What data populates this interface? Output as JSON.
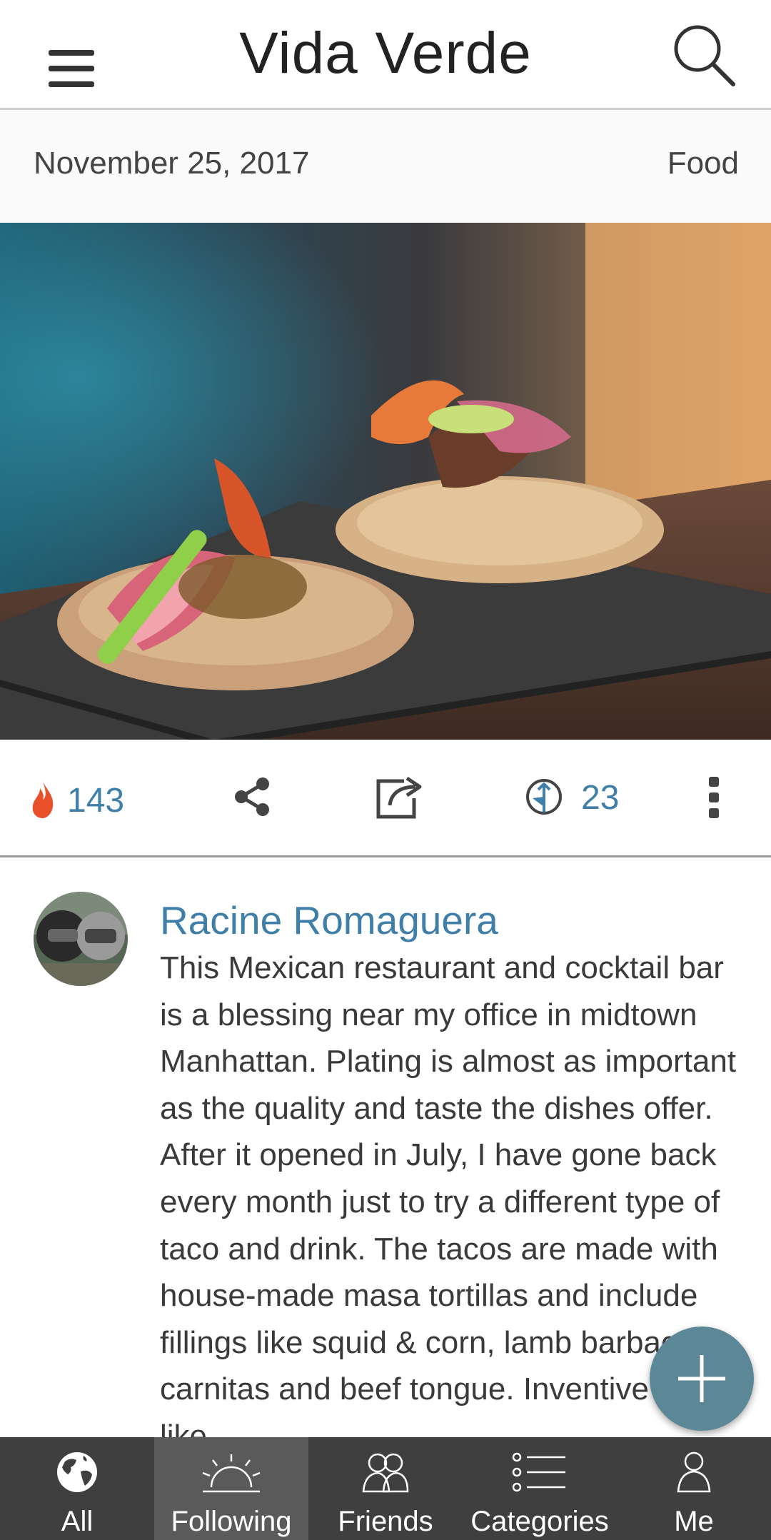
{
  "header": {
    "title": "Vida Verde",
    "menu_icon": "hamburger-icon",
    "search_icon": "search-icon"
  },
  "post": {
    "date": "November 25, 2017",
    "category": "Food",
    "image_icon": "food-photo"
  },
  "actions": {
    "likes": "143",
    "like_icon": "flame-icon",
    "share_icon": "share-icon",
    "open_icon": "external-link-icon",
    "comments": "23",
    "comment_icon": "comment-icon",
    "more_icon": "more-vertical-icon",
    "accent_color": "#3f7fa8",
    "flame_color": "#e8502a"
  },
  "comment": {
    "author": "Racine Romaguera",
    "text": "This Mexican restaurant and cocktail bar is a blessing near my office in midtown Manhattan. Plating is almost as important as the quality and taste the dishes offer. After it opened in July, I have gone back every month just to try a different type of taco and drink. The tacos are made with house-made masa tortillas and include fillings like squid & corn, lamb barbacoa, carnitas and beef tongue. Inventive drinks like"
  },
  "fab": {
    "icon": "plus-icon",
    "color": "#5b8797"
  },
  "nav": {
    "items": [
      {
        "label": "All",
        "icon": "globe-icon"
      },
      {
        "label": "Following",
        "icon": "sunrise-icon",
        "active": true
      },
      {
        "label": "Friends",
        "icon": "friends-icon"
      },
      {
        "label": "Categories",
        "icon": "list-icon"
      },
      {
        "label": "Me",
        "icon": "person-icon"
      }
    ]
  }
}
